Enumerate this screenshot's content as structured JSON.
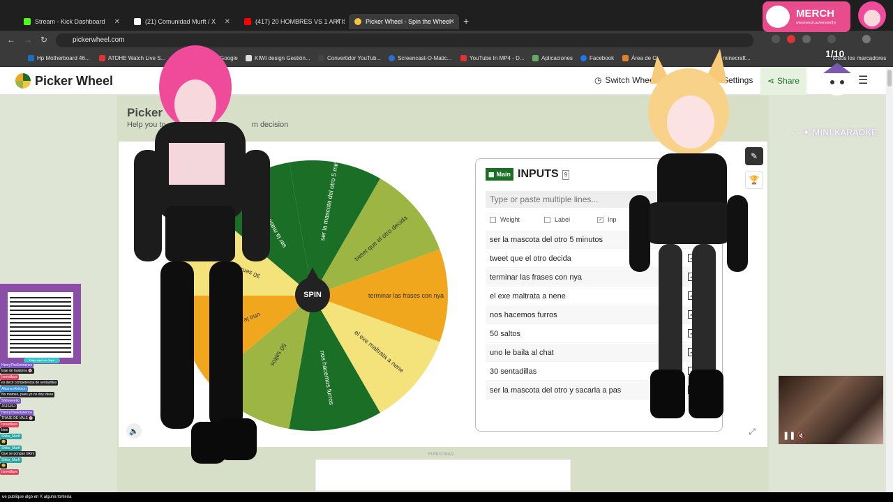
{
  "browser": {
    "tabs": [
      {
        "label": "Stream - Kick Dashboard",
        "color": "#53fc18"
      },
      {
        "label": "(21) Comunidad Murft / X",
        "color": "#ffffff"
      },
      {
        "label": "(417) 20 HOMBRES VS 1 ARTIS",
        "color": "#ff0000"
      },
      {
        "label": "Picker Wheel - Spin the Wheel",
        "color": "#f4c542"
      }
    ],
    "url": "pickerwheel.com",
    "bookmarks": [
      {
        "label": "Hp Motherboard 46...",
        "color": "#1b6ec2"
      },
      {
        "label": "ATDHE Watch Live S...",
        "color": "#d33"
      },
      {
        "label": "Google",
        "color": "#fff"
      },
      {
        "label": "KIWI design Gestión...",
        "color": "#ddd"
      },
      {
        "label": "Convertidor YouTub...",
        "color": "#444"
      },
      {
        "label": "Screencast-O-Matic...",
        "color": "#2a6fd6"
      },
      {
        "label": "YouTube In MP4 - D...",
        "color": "#d33"
      },
      {
        "label": "Aplicaciones",
        "color": "#6a6"
      },
      {
        "label": "Facebook",
        "color": "#1877f2"
      },
      {
        "label": "Área de C",
        "color": "#e08030"
      },
      {
        "label": "minecraft...",
        "color": "#7a5"
      },
      {
        "label": "Todos los marcadores",
        "color": "#ccc"
      }
    ]
  },
  "header": {
    "brand": "Picker Wheel",
    "switch_wheel": "Switch Whee",
    "settings": "Settings",
    "share": "Share"
  },
  "page": {
    "title": "Picker",
    "subtitle_left": "Help you to",
    "subtitle_right": "m decision"
  },
  "wheel": {
    "spin_label": "SPIN",
    "segments": [
      {
        "label": "ser la mascota del otro 5 minu...",
        "color": "#1b6e26"
      },
      {
        "label": "tweet que el otro decida",
        "color": "#9db542"
      },
      {
        "label": "terminar las frases con nya",
        "color": "#f0a71e"
      },
      {
        "label": "el exe maltrata a nene",
        "color": "#f4e27a"
      },
      {
        "label": "nos hacemos furros",
        "color": "#1b6e26"
      },
      {
        "label": "50 saltos",
        "color": "#9db542"
      },
      {
        "label": "uno le baila al chat",
        "color": "#f0a71e"
      },
      {
        "label": "30 sentadillas",
        "color": "#f4e27a"
      },
      {
        "label": "ser la mascota del otro y saca...",
        "color": "#1b6e26"
      }
    ]
  },
  "inputs": {
    "tag": "Main",
    "title": "INPUTS",
    "count": "9",
    "placeholder": "Type or paste multiple lines...",
    "options": [
      "Weight",
      "Label",
      "Inp"
    ],
    "entries": [
      "ser la mascota del otro 5 minutos",
      "tweet que el otro decida",
      "terminar las frases con nya",
      "el exe maltrata a nene",
      "nos hacemos furros",
      "50 saltos",
      "uno le baila al chat",
      "30 sentadillas",
      "ser la mascota del otro y sacarla a pas"
    ]
  },
  "ad": {
    "label": "PUBLICIDAD"
  },
  "overlay": {
    "merch": "MERCH",
    "merch_url": "www.merch.us/vemeerthy",
    "pager": "1/10",
    "karaoke": "· · ✦ MINI KARAOKE",
    "qr_caption": "Paga aquí con Yape",
    "chat": [
      {
        "name": "HenryTheEminence",
        "msg": "traje de bailarina 🌸",
        "color": "purple"
      },
      {
        "name": "Isroedlaze",
        "msg": "es decir competencia de sentadillas",
        "color": "red"
      },
      {
        "name": "AlbanezAirikson",
        "msg": "No mames, pues yo no doy ideas",
        "color": "blue"
      },
      {
        "name": "Shifuweebo",
        "msg": "JSJSJSJ",
        "color": "purple"
      },
      {
        "name": "HenryTheEminence",
        "msg": "TRAJE DE VALE 🌸",
        "color": "purple"
      },
      {
        "name": "Isroedlaze",
        "msg": "bien",
        "color": "red"
      },
      {
        "name": "Shibs_Murft",
        "msg": "😊",
        "color": "teal"
      },
      {
        "name": "Shibs_Murft",
        "msg": "Que se pongan bikini",
        "color": "teal"
      },
      {
        "name": "Shibs_Murft",
        "msg": "😊",
        "color": "teal"
      },
      {
        "name": "Isroedlaze",
        "msg": "",
        "color": "red"
      }
    ],
    "bottom_text": "ue publique algo en X alguna tonteria"
  }
}
